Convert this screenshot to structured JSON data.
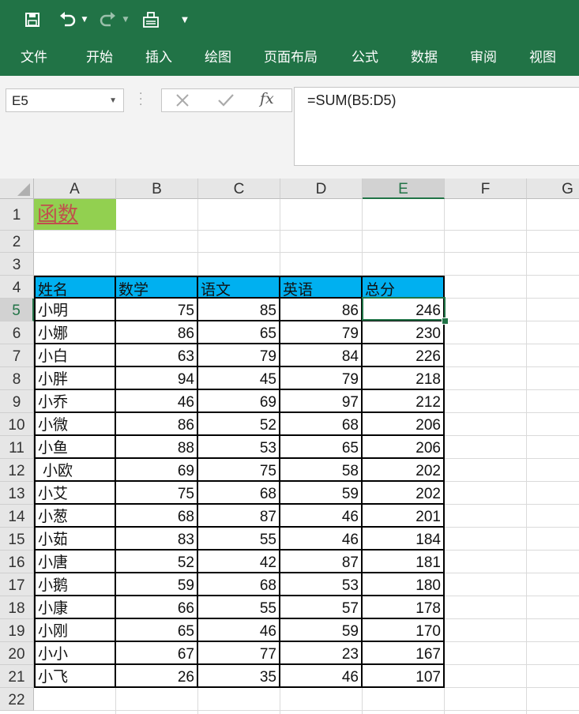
{
  "qat": {
    "save_icon": "save-icon",
    "undo_icon": "undo-icon",
    "redo_icon": "redo-icon",
    "format_painter_icon": "format-painter-icon",
    "customize_icon": "customize-qat-icon"
  },
  "ribbon_tabs": [
    "文件",
    "开始",
    "插入",
    "绘图",
    "页面布局",
    "公式",
    "数据",
    "审阅",
    "视图"
  ],
  "formula_bar": {
    "name_box": "E5",
    "cancel_icon": "cancel-icon",
    "enter_icon": "check-icon",
    "fx_label": "fx",
    "formula": "=SUM(B5:D5)"
  },
  "sheet": {
    "columns": [
      "A",
      "B",
      "C",
      "D",
      "E",
      "F",
      "G"
    ],
    "row_numbers": [
      "1",
      "2",
      "3",
      "4",
      "5",
      "6",
      "7",
      "8",
      "9",
      "10",
      "11",
      "12",
      "13",
      "14",
      "15",
      "16",
      "17",
      "18",
      "19",
      "20",
      "21",
      "22"
    ],
    "selected_cell": "E5",
    "title": "函数",
    "headers": [
      "姓名",
      "数学",
      "语文",
      "英语",
      "总分"
    ],
    "rows": [
      [
        "小明",
        "75",
        "85",
        "86",
        "246"
      ],
      [
        "小娜",
        "86",
        "65",
        "79",
        "230"
      ],
      [
        "小白",
        "63",
        "79",
        "84",
        "226"
      ],
      [
        "小胖",
        "94",
        "45",
        "79",
        "218"
      ],
      [
        "小乔",
        "46",
        "69",
        "97",
        "212"
      ],
      [
        "小微",
        "86",
        "52",
        "68",
        "206"
      ],
      [
        "小鱼",
        "88",
        "53",
        "65",
        "206"
      ],
      [
        " 小欧",
        "69",
        "75",
        "58",
        "202"
      ],
      [
        "小艾",
        "75",
        "68",
        "59",
        "202"
      ],
      [
        "小葱",
        "68",
        "87",
        "46",
        "201"
      ],
      [
        "小茹",
        "83",
        "55",
        "46",
        "184"
      ],
      [
        "小唐",
        "52",
        "42",
        "87",
        "181"
      ],
      [
        "小鹅",
        "59",
        "68",
        "53",
        "180"
      ],
      [
        "小康",
        "66",
        "55",
        "57",
        "178"
      ],
      [
        "小刚",
        "65",
        "46",
        "59",
        "170"
      ],
      [
        "小小",
        "67",
        "77",
        "23",
        "167"
      ],
      [
        "小飞",
        "26",
        "35",
        "46",
        "107"
      ]
    ]
  },
  "colors": {
    "ribbon": "#217346",
    "title_fill": "#92d050",
    "title_text": "#c0504d",
    "header_fill": "#00b0f0"
  }
}
